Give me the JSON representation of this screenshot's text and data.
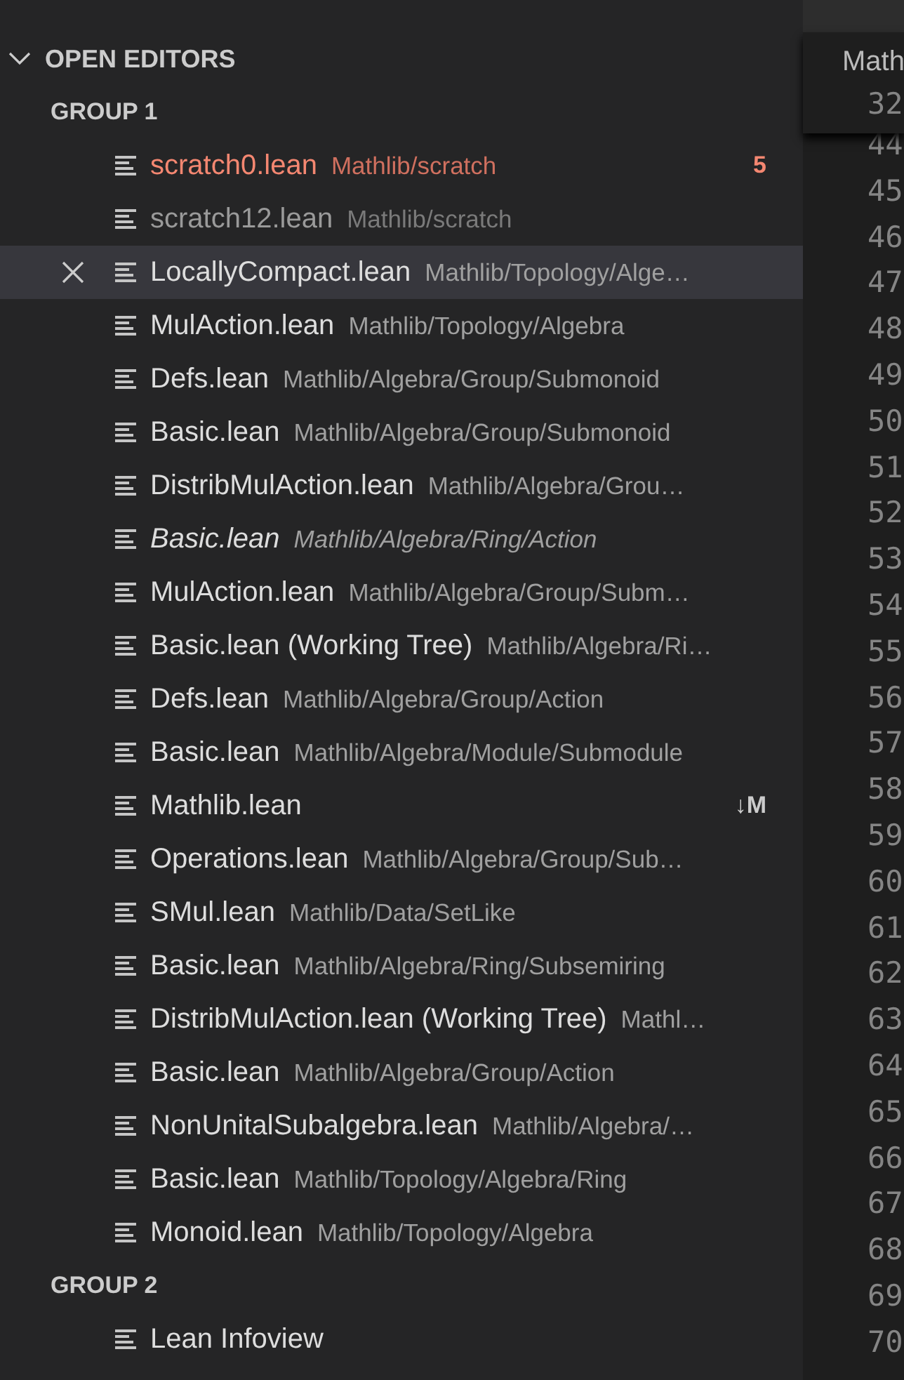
{
  "section": {
    "title": "OPEN EDITORS",
    "expanded": true
  },
  "groups": [
    {
      "title": "GROUP 1",
      "editors": [
        {
          "name": "scratch0.lean",
          "path": "Mathlib/scratch",
          "kind": "error",
          "badge": "5",
          "selected": false
        },
        {
          "name": "scratch12.lean",
          "path": "Mathlib/scratch",
          "kind": "dimmed",
          "selected": false
        },
        {
          "name": "LocallyCompact.lean",
          "path": "Mathlib/Topology/Alge…",
          "kind": "normal",
          "selected": true
        },
        {
          "name": "MulAction.lean",
          "path": "Mathlib/Topology/Algebra",
          "kind": "normal",
          "selected": false
        },
        {
          "name": "Defs.lean",
          "path": "Mathlib/Algebra/Group/Submonoid",
          "kind": "normal",
          "selected": false
        },
        {
          "name": "Basic.lean",
          "path": "Mathlib/Algebra/Group/Submonoid",
          "kind": "normal",
          "selected": false
        },
        {
          "name": "DistribMulAction.lean",
          "path": "Mathlib/Algebra/Grou…",
          "kind": "normal",
          "selected": false
        },
        {
          "name": "Basic.lean",
          "path": "Mathlib/Algebra/Ring/Action",
          "kind": "preview",
          "selected": false
        },
        {
          "name": "MulAction.lean",
          "path": "Mathlib/Algebra/Group/Subm…",
          "kind": "normal",
          "selected": false
        },
        {
          "name": "Basic.lean (Working Tree)",
          "path": "Mathlib/Algebra/Ri…",
          "kind": "normal",
          "selected": false
        },
        {
          "name": "Defs.lean",
          "path": "Mathlib/Algebra/Group/Action",
          "kind": "normal",
          "selected": false
        },
        {
          "name": "Basic.lean",
          "path": "Mathlib/Algebra/Module/Submodule",
          "kind": "normal",
          "selected": false
        },
        {
          "name": "Mathlib.lean",
          "kind": "normal",
          "badge": "↓M",
          "selected": false
        },
        {
          "name": "Operations.lean",
          "path": "Mathlib/Algebra/Group/Sub…",
          "kind": "normal",
          "selected": false
        },
        {
          "name": "SMul.lean",
          "path": "Mathlib/Data/SetLike",
          "kind": "normal",
          "selected": false
        },
        {
          "name": "Basic.lean",
          "path": "Mathlib/Algebra/Ring/Subsemiring",
          "kind": "normal",
          "selected": false
        },
        {
          "name": "DistribMulAction.lean (Working Tree)",
          "path": "Mathl…",
          "kind": "normal",
          "selected": false
        },
        {
          "name": "Basic.lean",
          "path": "Mathlib/Algebra/Group/Action",
          "kind": "normal",
          "selected": false
        },
        {
          "name": "NonUnitalSubalgebra.lean",
          "path": "Mathlib/Algebra/…",
          "kind": "normal",
          "selected": false
        },
        {
          "name": "Basic.lean",
          "path": "Mathlib/Topology/Algebra/Ring",
          "kind": "normal",
          "selected": false
        },
        {
          "name": "Monoid.lean",
          "path": "Mathlib/Topology/Algebra",
          "kind": "normal",
          "selected": false
        }
      ]
    },
    {
      "title": "GROUP 2",
      "editors": [
        {
          "name": "Lean Infoview",
          "kind": "normal",
          "selected": false
        }
      ]
    }
  ],
  "editor": {
    "breadcrumb": "Math",
    "hover_line": "32",
    "line_numbers": [
      "44",
      "45",
      "46",
      "47",
      "48",
      "49",
      "50",
      "51",
      "52",
      "53",
      "54",
      "55",
      "56",
      "57",
      "58",
      "59",
      "60",
      "61",
      "62",
      "63",
      "64",
      "65",
      "66",
      "67",
      "68",
      "69",
      "70"
    ]
  }
}
